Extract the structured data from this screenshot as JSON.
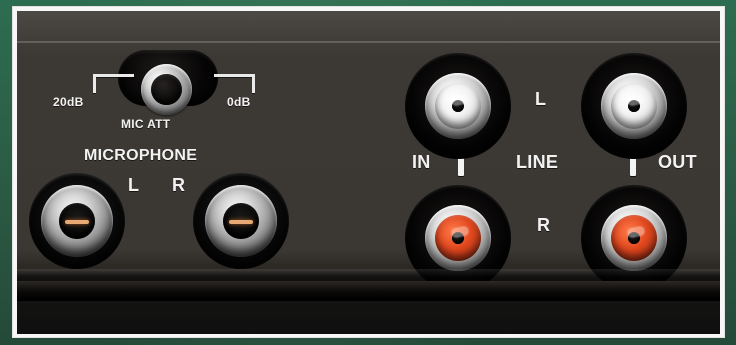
{
  "labels": {
    "mic_left_attenuation": "20dB",
    "mic_att": "MIC ATT",
    "mic_right_attenuation": "0dB",
    "microphone": "MICROPHONE",
    "microphone_L": "L",
    "microphone_R": "R",
    "line_L": "L",
    "line_in": "IN",
    "line": "LINE",
    "line_out": "OUT",
    "line_R": "R"
  },
  "colors": {
    "background_green": "#2f6a4d",
    "panel": "#3b3833",
    "label_white": "#f2f2f2",
    "rca_red": "#e1471e",
    "rca_white": "#f3f3f3"
  },
  "icons": {
    "mic_att_switch": "mic-attenuator-switch-icon",
    "mic_jack": "microphone-jack-icon",
    "rca_socket": "rca-socket-icon"
  }
}
